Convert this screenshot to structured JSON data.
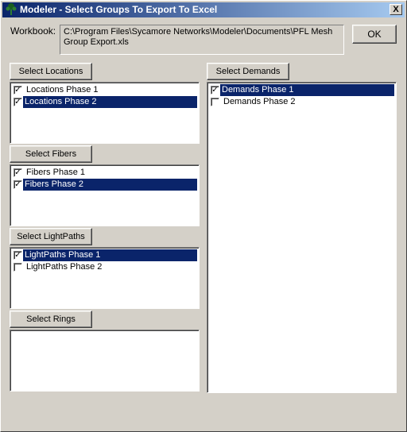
{
  "window": {
    "title": "Modeler - Select Groups To Export To Excel",
    "close_label": "X"
  },
  "workbook": {
    "label": "Workbook:",
    "path": "C:\\Program Files\\Sycamore Networks\\Modeler\\Documents\\PFL Mesh Group Export.xls"
  },
  "ok_label": "OK",
  "groups": {
    "locations": {
      "button": "Select Locations",
      "items": [
        {
          "label": "Locations Phase 1",
          "checked": true,
          "selected": false
        },
        {
          "label": "Locations Phase 2",
          "checked": true,
          "selected": true
        }
      ]
    },
    "fibers": {
      "button": "Select Fibers",
      "items": [
        {
          "label": "Fibers Phase 1",
          "checked": true,
          "selected": false
        },
        {
          "label": "Fibers Phase 2",
          "checked": true,
          "selected": true
        }
      ]
    },
    "lightpaths": {
      "button": "Select LightPaths",
      "items": [
        {
          "label": "LightPaths Phase 1",
          "checked": true,
          "selected": true
        },
        {
          "label": "LightPaths Phase 2",
          "checked": false,
          "selected": false
        }
      ]
    },
    "rings": {
      "button": "Select Rings",
      "items": []
    },
    "demands": {
      "button": "Select Demands",
      "items": [
        {
          "label": "Demands Phase 1",
          "checked": true,
          "selected": true
        },
        {
          "label": "Demands Phase 2",
          "checked": false,
          "selected": false
        }
      ]
    }
  }
}
